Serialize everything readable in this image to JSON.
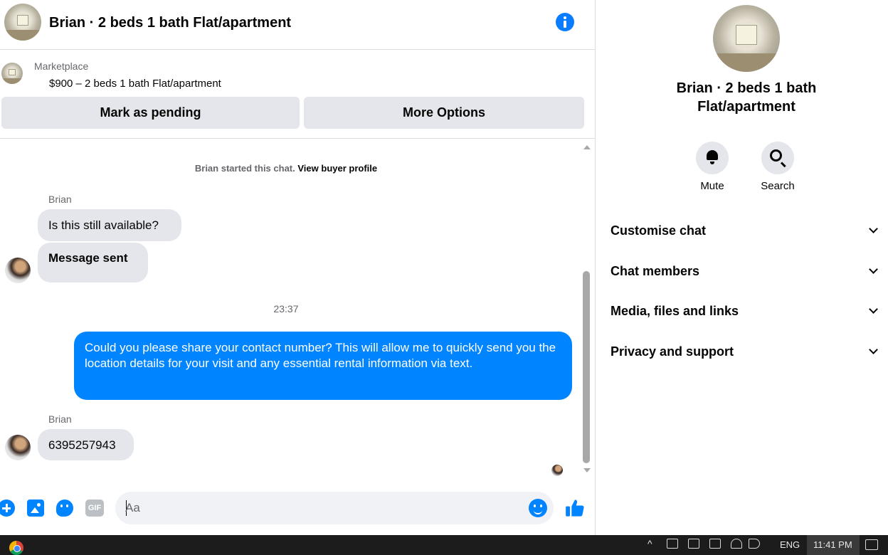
{
  "header": {
    "title": "Brian · 2 beds 1 bath Flat/apartment"
  },
  "listing": {
    "source": "Marketplace",
    "price_line": "$900 – 2 beds 1 bath Flat/apartment",
    "pending_button": "Mark as pending",
    "more_button": "More Options"
  },
  "conversation": {
    "notice_prefix": "Brian started this chat.",
    "notice_link": "View buyer profile",
    "sender1": "Brian",
    "msg1": "Is this still available?",
    "msg2": "Message sent",
    "time_separator": "23:37",
    "outgoing": "Could you please share your contact number? This will allow me to quickly send you the location details for your visit and any essential rental information via text.",
    "sender2": "Brian",
    "msg3": "6395257943"
  },
  "composer": {
    "gif_label": "GIF",
    "placeholder": "Aa"
  },
  "info_panel": {
    "title": "Brian · 2 beds 1 bath Flat/apartment",
    "mute_label": "Mute",
    "search_label": "Search",
    "sections": [
      "Customise chat",
      "Chat members",
      "Media, files and links",
      "Privacy and support"
    ]
  },
  "taskbar": {
    "language": "ENG",
    "clock": "11:41 PM"
  },
  "colors": {
    "accent": "#0084ff",
    "bubble_incoming": "#e4e6eb",
    "taskbar": "#1c1c1c"
  },
  "icons": [
    "info-icon",
    "plus-icon",
    "photo-icon",
    "sticker-icon",
    "gif-icon",
    "emoji-icon",
    "like-icon",
    "bell-icon",
    "search-icon",
    "chevron-down-icon",
    "chrome-icon"
  ]
}
